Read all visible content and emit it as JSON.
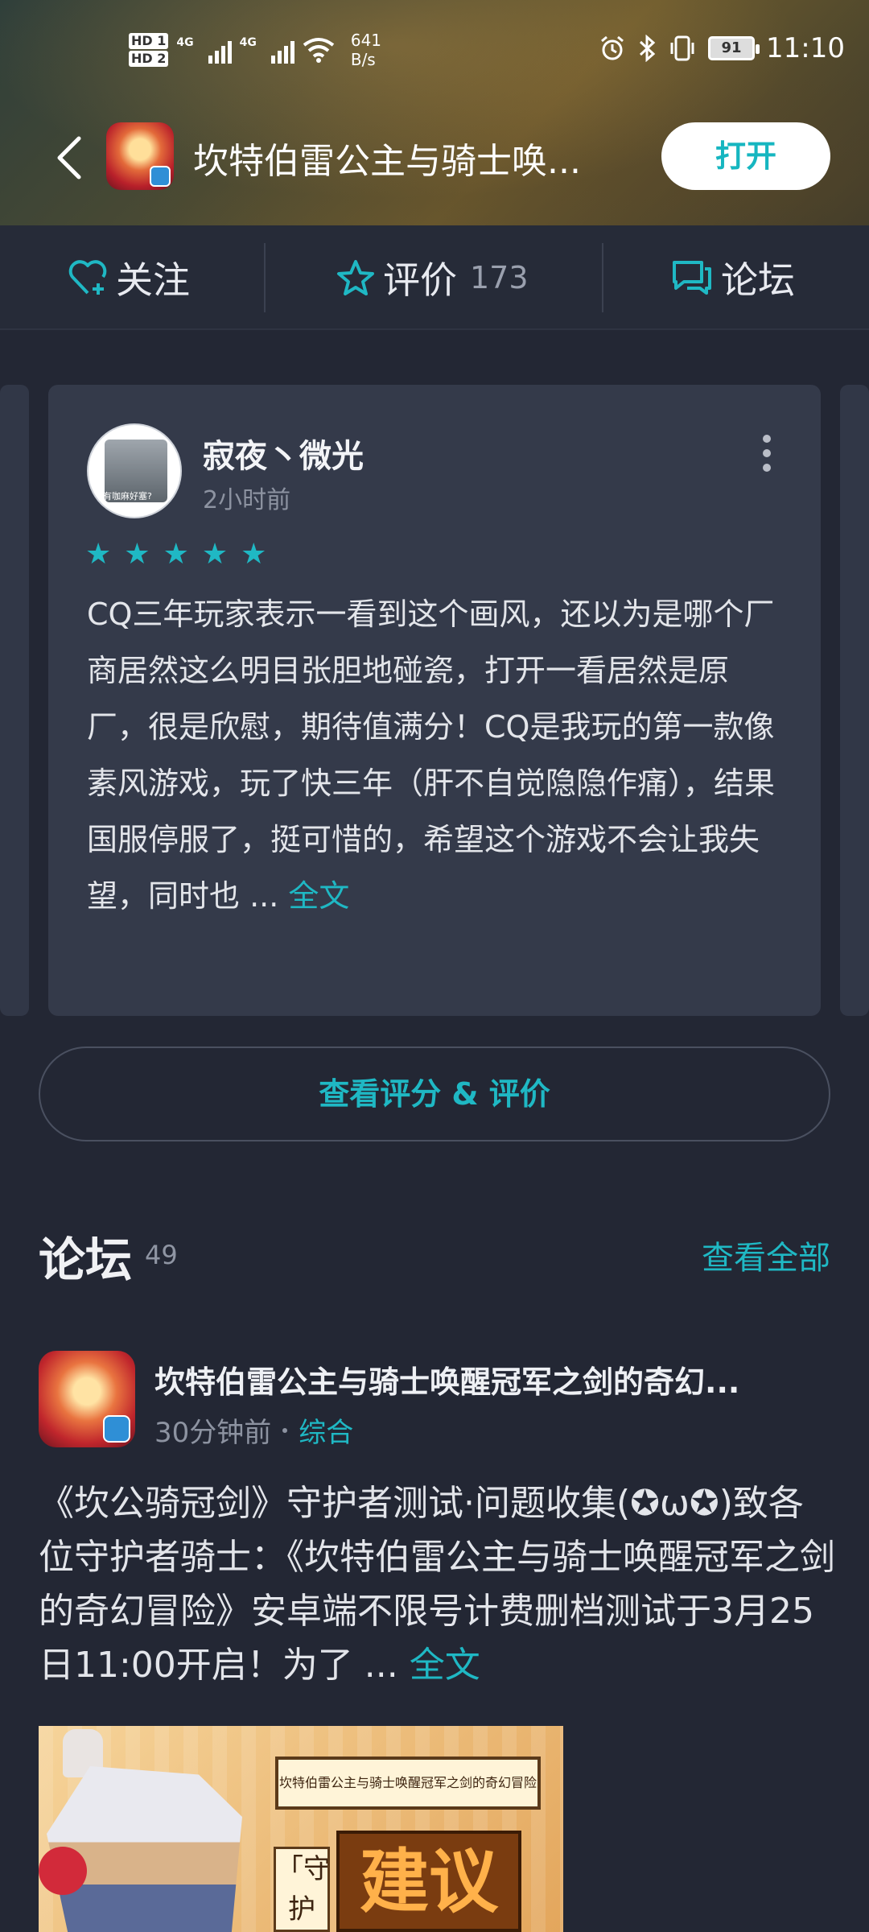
{
  "status_bar": {
    "hd1": "HD 1",
    "hd2": "HD 2",
    "net1": "4G",
    "net2": "4G",
    "speed_value": "641",
    "speed_unit": "B/s",
    "battery": "91",
    "time": "11:10"
  },
  "app_bar": {
    "title": "坎特伯雷公主与骑士唤...",
    "open_label": "打开"
  },
  "tabs": {
    "follow": "关注",
    "rate": "评价",
    "rate_count": "173",
    "forum": "论坛"
  },
  "review": {
    "avatar_caption": "有咖麻好塞?",
    "author": "寂夜丶微光",
    "time": "2小时前",
    "rating": 5,
    "text": "CQ三年玩家表示一看到这个画风，还以为是哪个厂商居然这么明目张胆地碰瓷，打开一看居然是原厂，很是欣慰，期待值满分！CQ是我玩的第一款像素风游戏，玩了快三年（肝不自觉隐隐作痛），结果国服停服了，挺可惜的，希望这个游戏不会让我失望，同时也 ...",
    "more_link": "全文"
  },
  "rate_button": "查看评分 & 评价",
  "forum": {
    "title": "论坛",
    "count": "49",
    "see_all": "查看全部",
    "post": {
      "title": "坎特伯雷公主与骑士唤醒冠军之剑的奇幻...",
      "time": "30分钟前",
      "tag": "综合",
      "body": "《坎公骑冠剑》守护者测试·问题收集(✪ω✪)致各位守护者骑士：《坎特伯雷公主与骑士唤醒冠军之剑的奇幻冒险》安卓端不限号计费删档测试于3月25日11:00开启！为了 ...",
      "more_link": "全文",
      "image_sign": "坎特伯雷公主与骑士唤醒冠军之剑的奇幻冒险",
      "image_side": "「守护者",
      "image_big": "建议"
    }
  },
  "colors": {
    "accent": "#1fb8c4",
    "background": "#232734",
    "card": "#343a4a"
  }
}
